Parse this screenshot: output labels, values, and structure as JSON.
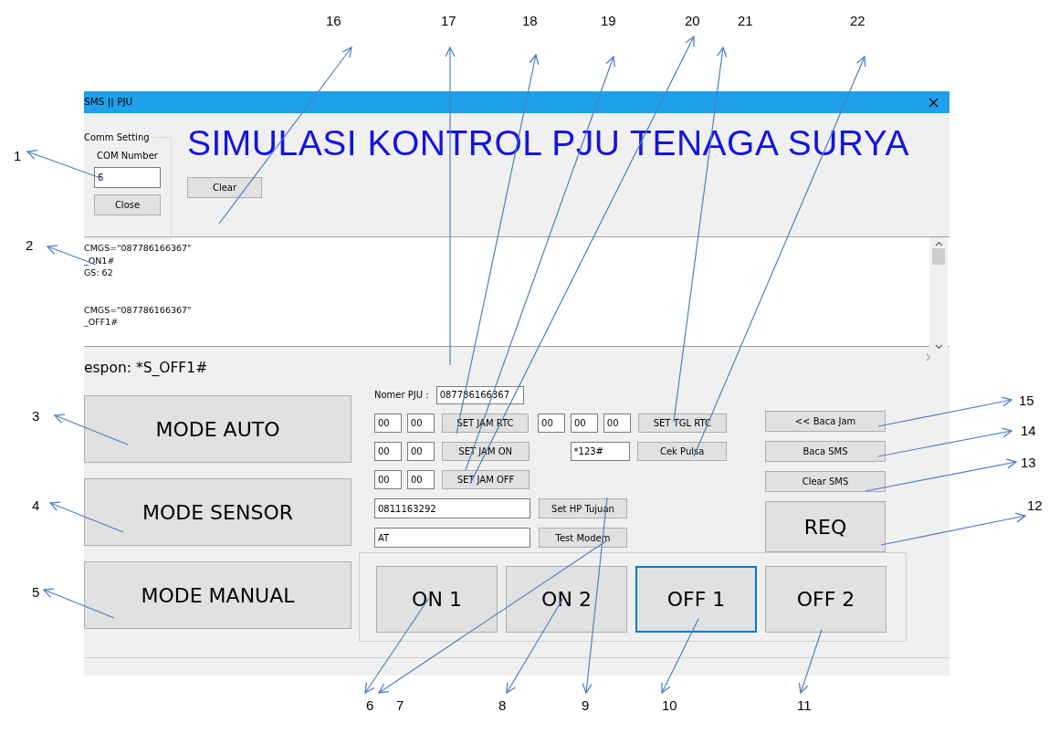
{
  "window": {
    "title": "SMS || PJU"
  },
  "comm_setting": {
    "title": "Comm Setting",
    "label": "COM Number",
    "com_number": "6",
    "button": "Close"
  },
  "heading": "SIMULASI KONTROL PJU TENAGA SURYA",
  "clear_button": "Clear",
  "log": {
    "entries": [
      {
        "lines": [
          "CMGS=\"087786166367\"",
          "_ON1#",
          "GS: 62"
        ]
      },
      {
        "lines": [
          "CMGS=\"087786166367\"",
          "_OFF1#"
        ]
      }
    ]
  },
  "response": "espon: *S_OFF1#",
  "mode_buttons": [
    "MODE AUTO",
    "MODE SENSOR",
    "MODE MANUAL"
  ],
  "pju": {
    "label": "Nomer PJU :",
    "value": "087786166367"
  },
  "time_rows": [
    {
      "hour": "00",
      "minute": "00",
      "button": "SET JAM RTC"
    },
    {
      "hour": "00",
      "minute": "00",
      "button": "SET JAM ON"
    },
    {
      "hour": "00",
      "minute": "00",
      "button": "SET JAM OFF"
    }
  ],
  "date": {
    "fields": [
      "00",
      "00",
      "00"
    ],
    "button": "SET TGL RTC"
  },
  "ussd": {
    "value": "*123#",
    "button": "Cek Pulsa"
  },
  "hp": {
    "value": "0811163292",
    "button": "Set HP Tujuan"
  },
  "modem": {
    "value": "AT",
    "button": "Test Modem"
  },
  "side_buttons": [
    "<< Baca Jam",
    "Baca SMS",
    "Clear SMS"
  ],
  "req_button": "REQ",
  "relay_buttons": [
    {
      "label": "ON 1",
      "focused": false
    },
    {
      "label": "ON 2",
      "focused": false
    },
    {
      "label": "OFF 1",
      "focused": true
    },
    {
      "label": "OFF 2",
      "focused": false
    }
  ],
  "callouts": [
    {
      "label": "16"
    },
    {
      "label": "17"
    },
    {
      "label": "18"
    },
    {
      "label": "19"
    },
    {
      "label": "20"
    },
    {
      "label": "21"
    },
    {
      "label": "22"
    },
    {
      "label": "1"
    },
    {
      "label": "2"
    },
    {
      "label": "15"
    },
    {
      "label": "3"
    },
    {
      "label": "14"
    },
    {
      "label": "13"
    },
    {
      "label": "4"
    },
    {
      "label": "12"
    },
    {
      "label": "5"
    },
    {
      "label": "6"
    },
    {
      "label": "7"
    },
    {
      "label": "8"
    },
    {
      "label": "9"
    },
    {
      "label": "10"
    },
    {
      "label": "11"
    }
  ]
}
